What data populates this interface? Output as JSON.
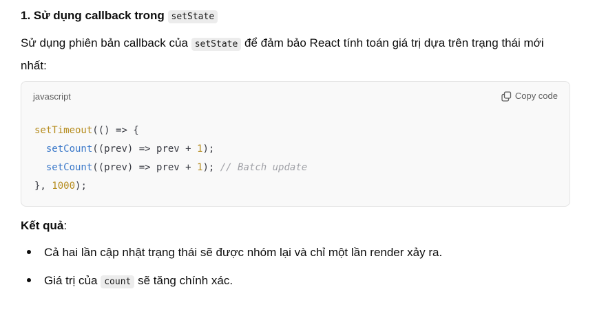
{
  "section": {
    "heading_text": "1. Sử dụng callback trong",
    "heading_code": "setState",
    "para_before": "Sử dụng phiên bản callback của",
    "para_code": "setState",
    "para_after": "để đảm bảo React tính toán giá trị dựa trên trạng thái mới nhất:"
  },
  "code_block": {
    "language": "javascript",
    "copy_label": "Copy code",
    "lines": {
      "l1_fn": "setTimeout",
      "l1_rest": "(() => {",
      "l2_fn": "setCount",
      "l2_rest": "((prev) => prev + ",
      "l2_num": "1",
      "l2_end": ");",
      "l3_fn": "setCount",
      "l3_rest": "((prev) => prev + ",
      "l3_num": "1",
      "l3_end": ");",
      "l3_comment": "// Batch update",
      "l4_start": "}, ",
      "l4_num": "1000",
      "l4_end": ");"
    }
  },
  "result": {
    "label": "Kết quả",
    "colon": ":",
    "bullet1": "Cả hai lần cập nhật trạng thái sẽ được nhóm lại và chỉ một lần render xảy ra.",
    "bullet2_before": "Giá trị của",
    "bullet2_code": "count",
    "bullet2_after": "sẽ tăng chính xác."
  },
  "icons": {
    "copy": "copy-icon"
  },
  "colors": {
    "code_bg": "#f9f9f9",
    "inline_code_bg": "#ececec",
    "function_yellow": "#b58b1c",
    "function_blue": "#3a78c9",
    "comment_gray": "#a0a1a7"
  }
}
